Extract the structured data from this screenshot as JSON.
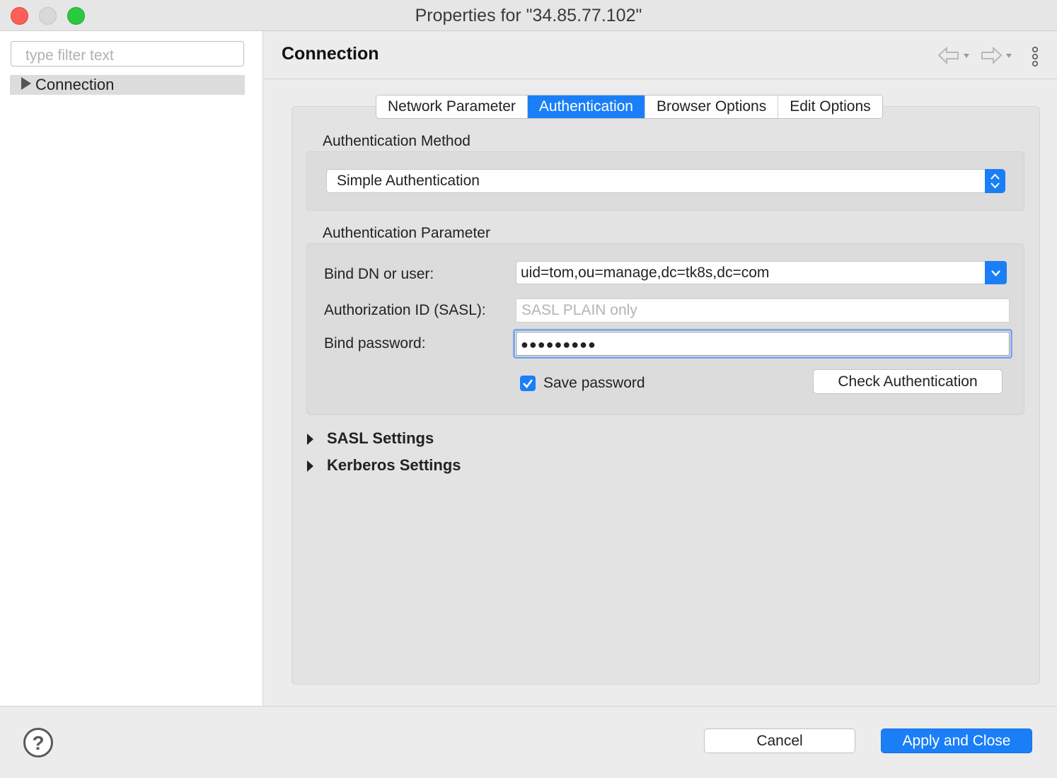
{
  "window": {
    "title": "Properties for \"34.85.77.102\""
  },
  "sidebar": {
    "filter_placeholder": "type filter text",
    "items": [
      {
        "label": "Connection"
      }
    ]
  },
  "header": {
    "title": "Connection"
  },
  "tabs": [
    {
      "label": "Network Parameter",
      "active": false
    },
    {
      "label": "Authentication",
      "active": true
    },
    {
      "label": "Browser Options",
      "active": false
    },
    {
      "label": "Edit Options",
      "active": false
    }
  ],
  "auth_method": {
    "group_label": "Authentication Method",
    "selected": "Simple Authentication"
  },
  "auth_param": {
    "group_label": "Authentication Parameter",
    "bind_dn_label": "Bind DN or user:",
    "bind_dn_value": "uid=tom,ou=manage,dc=tk8s,dc=com",
    "authz_label": "Authorization ID (SASL):",
    "authz_placeholder": "SASL PLAIN only",
    "password_label": "Bind password:",
    "password_mask": "●●●●●●●●●",
    "save_password_label": "Save password",
    "save_password_checked": true,
    "check_auth_label": "Check Authentication"
  },
  "sections": {
    "sasl": "SASL Settings",
    "kerberos": "Kerberos Settings"
  },
  "footer": {
    "help_glyph": "?",
    "cancel_label": "Cancel",
    "apply_label": "Apply and Close"
  },
  "colors": {
    "accent": "#1a7ff7"
  }
}
